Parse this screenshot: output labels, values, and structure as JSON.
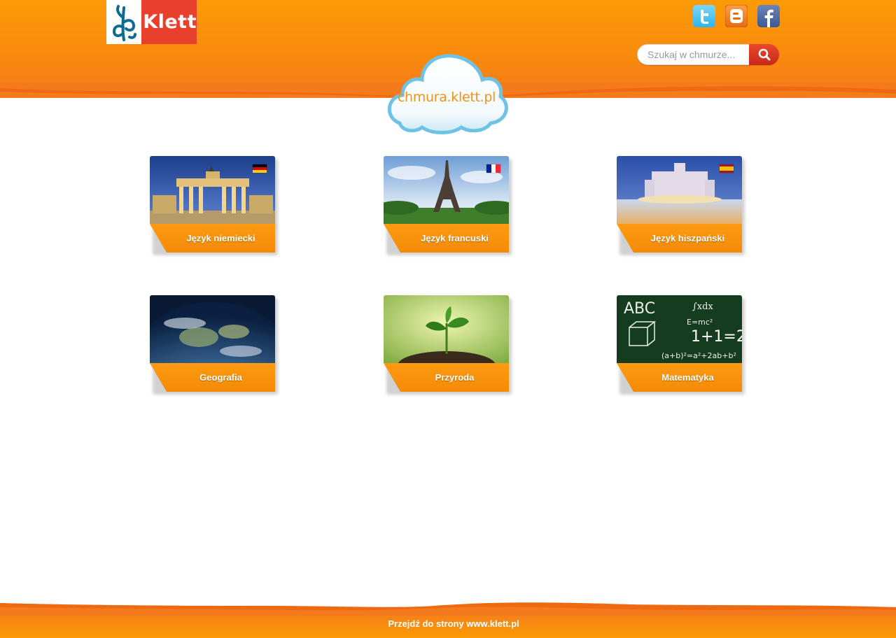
{
  "header": {
    "logo": {
      "text": "Klett",
      "brand_color": "#e8402d",
      "mark_color": "#0c6b95"
    },
    "social": [
      {
        "name": "twitter",
        "icon": "twitter-icon",
        "color": "#2fb5e8"
      },
      {
        "name": "blogger",
        "icon": "blogger-icon",
        "color": "#f57d00"
      },
      {
        "name": "facebook",
        "icon": "facebook-icon",
        "color": "#3b5998"
      }
    ],
    "search": {
      "placeholder": "Szukaj w chmurze...",
      "value": "",
      "icon": "search-icon"
    },
    "cloud_title": "chmura.klett.pl"
  },
  "subjects": [
    {
      "label": "Język niemiecki",
      "flag": "germany",
      "image": "brandenburg-gate"
    },
    {
      "label": "Język francuski",
      "flag": "france",
      "image": "eiffel-tower"
    },
    {
      "label": "Język hiszpański",
      "flag": "spain",
      "image": "madrid-palace"
    },
    {
      "label": "Geografia",
      "flag": "",
      "image": "earth-globe"
    },
    {
      "label": "Przyroda",
      "flag": "",
      "image": "seedling"
    },
    {
      "label": "Matematyka",
      "flag": "",
      "image": "chalkboard"
    }
  ],
  "footer": {
    "link_text": "Przejdź do strony www.klett.pl"
  },
  "colors": {
    "accent_orange": "#f9890e",
    "tile_orange": "#f58a06",
    "search_red": "#c8261a"
  }
}
